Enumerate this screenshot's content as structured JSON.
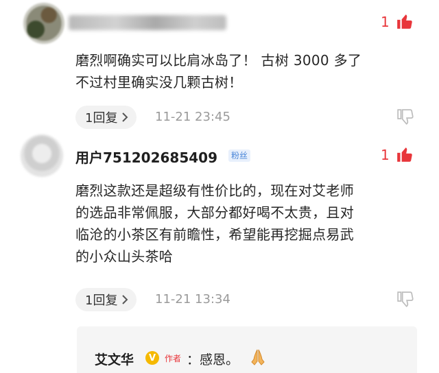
{
  "comments": [
    {
      "user": "",
      "likes": "1",
      "text_lines": [
        "磨烈啊确实可以比肩冰岛了！ 古树 3000 多了",
        "不过村里确实没几颗古树！"
      ],
      "reply_label": "1回复",
      "timestamp": "11-21 23:45"
    },
    {
      "user": "用户751202685409",
      "badge": "粉丝",
      "likes": "1",
      "text_lines": [
        "磨烈这款还是超级有性价比的，现在对艾老师",
        "的选品非常佩服，大部分都好喝不太贵，且对",
        "临沧的小茶区有前瞻性，希望能再挖掘点易武",
        "的小众山头茶哈"
      ],
      "reply_label": "1回复",
      "timestamp": "11-21 13:34"
    }
  ],
  "author_reply": {
    "name": "艾文华",
    "verified_glyph": "V",
    "tag": "作者",
    "text": "：感恩。"
  },
  "colors": {
    "accent_red": "#e8363b",
    "badge_blue": "#4a86d8",
    "verified_gold": "#f5b900"
  },
  "icons": [
    "thumbs-up-icon",
    "thumbs-down-icon",
    "chevron-right-icon",
    "praying-hands-icon",
    "verified-icon"
  ]
}
